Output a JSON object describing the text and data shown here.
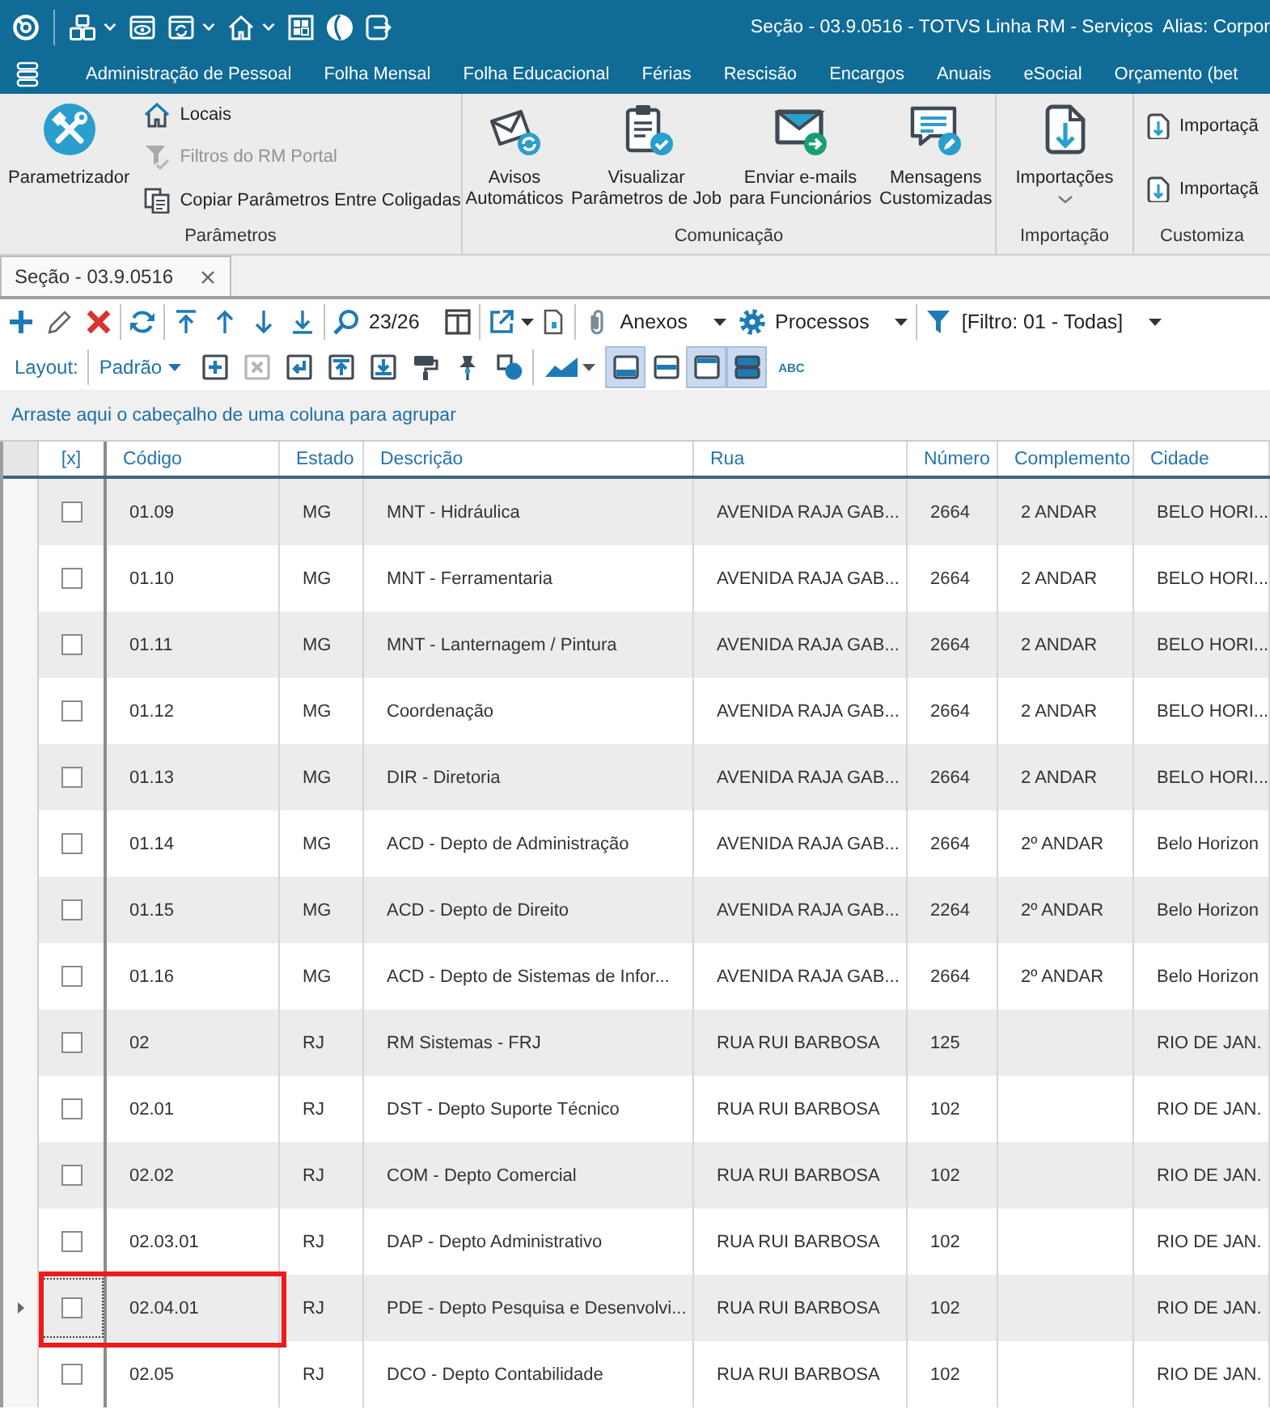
{
  "title_bar": {
    "title": "Seção - 03.9.0516 - TOTVS Linha RM - Serviços  Alias: Corpor"
  },
  "menu": [
    "Administração de Pessoal",
    "Folha Mensal",
    "Folha Educacional",
    "Férias",
    "Rescisão",
    "Encargos",
    "Anuais",
    "eSocial",
    "Orçamento (bet"
  ],
  "ribbon": {
    "groups": [
      {
        "label": "Parâmetros",
        "large": [
          {
            "label": "Parametrizador"
          }
        ],
        "small": [
          {
            "label": "Locais",
            "disabled": false
          },
          {
            "label": "Filtros do RM Portal",
            "disabled": true
          },
          {
            "label": "Copiar Parâmetros Entre Coligadas",
            "disabled": false
          }
        ]
      },
      {
        "label": "Comunicação",
        "large": [
          {
            "label": "Avisos\nAutomáticos"
          },
          {
            "label": "Visualizar\nParâmetros de Job"
          },
          {
            "label": "Enviar e-mails\npara Funcionários"
          },
          {
            "label": "Mensagens\nCustomizadas"
          }
        ]
      },
      {
        "label": "Importação",
        "large": [
          {
            "label": "Importações",
            "dropdown": true
          }
        ]
      },
      {
        "label": "Customiza",
        "small": [
          {
            "label": "Importaçã",
            "disabled": false
          },
          {
            "label": "Importaçã",
            "disabled": false
          }
        ]
      }
    ]
  },
  "tabs": [
    {
      "label": "Seção - 03.9.0516",
      "selected": true
    }
  ],
  "toolbar": {
    "record_counter": "23/26",
    "attachments": "Anexos",
    "processes": "Processos",
    "filter": "[Filtro: 01 - Todas]"
  },
  "layout_bar": {
    "label": "Layout:",
    "layout": "Padrão",
    "tools": [
      {
        "disabled": false
      },
      {
        "disabled": true
      },
      {
        "disabled": false
      },
      {
        "disabled": false
      },
      {
        "disabled": false
      },
      {
        "disabled": false
      },
      {
        "disabled": false
      },
      {
        "disabled": false
      }
    ],
    "view_toggles": [
      {
        "selected": true
      },
      {
        "selected": false
      },
      {
        "selected": true
      },
      {
        "selected": true
      }
    ],
    "spelling": "ABC"
  },
  "group_panel": {
    "hint": "Arraste aqui o cabeçalho de uma coluna para agrupar"
  },
  "table": {
    "columns": [
      "[x]",
      "Código",
      "Estado",
      "Descrição",
      "Rua",
      "Número",
      "Complemento",
      "Cidade"
    ],
    "rows": [
      {
        "checked": false,
        "selected": false,
        "highlighted": false,
        "code": "01.09",
        "state": "MG",
        "description": "MNT - Hidráulica",
        "street": "AVENIDA RAJA GAB...",
        "number": "2664",
        "complement": "2 ANDAR",
        "city": "BELO HORI..."
      },
      {
        "checked": false,
        "selected": false,
        "highlighted": false,
        "code": "01.10",
        "state": "MG",
        "description": "MNT - Ferramentaria",
        "street": "AVENIDA RAJA GAB...",
        "number": "2664",
        "complement": "2 ANDAR",
        "city": "BELO HORI..."
      },
      {
        "checked": false,
        "selected": false,
        "highlighted": false,
        "code": "01.11",
        "state": "MG",
        "description": "MNT - Lanternagem / Pintura",
        "street": "AVENIDA RAJA GAB...",
        "number": "2664",
        "complement": "2 ANDAR",
        "city": "BELO HORI..."
      },
      {
        "checked": false,
        "selected": false,
        "highlighted": false,
        "code": "01.12",
        "state": "MG",
        "description": "Coordenação",
        "street": "AVENIDA RAJA GAB...",
        "number": "2664",
        "complement": "2 ANDAR",
        "city": "BELO HORI..."
      },
      {
        "checked": false,
        "selected": false,
        "highlighted": false,
        "code": "01.13",
        "state": "MG",
        "description": "DIR - Diretoria",
        "street": "AVENIDA RAJA GAB...",
        "number": "2664",
        "complement": "2 ANDAR",
        "city": "BELO HORI..."
      },
      {
        "checked": false,
        "selected": false,
        "highlighted": false,
        "code": "01.14",
        "state": "MG",
        "description": "ACD - Depto de Administração",
        "street": "AVENIDA RAJA GAB...",
        "number": "2664",
        "complement": "2º ANDAR",
        "city": "Belo Horizon"
      },
      {
        "checked": false,
        "selected": false,
        "highlighted": false,
        "code": "01.15",
        "state": "MG",
        "description": "ACD - Depto de Direito",
        "street": "AVENIDA RAJA GAB...",
        "number": "2264",
        "complement": "2º ANDAR",
        "city": "Belo Horizon"
      },
      {
        "checked": false,
        "selected": false,
        "highlighted": false,
        "code": "01.16",
        "state": "MG",
        "description": "ACD - Depto de Sistemas de Infor...",
        "street": "AVENIDA RAJA GAB...",
        "number": "2664",
        "complement": "2º ANDAR",
        "city": "Belo Horizon"
      },
      {
        "checked": false,
        "selected": false,
        "highlighted": false,
        "code": "02",
        "state": "RJ",
        "description": "RM Sistemas - FRJ",
        "street": "RUA RUI BARBOSA",
        "number": "125",
        "city": "RIO DE JAN."
      },
      {
        "checked": false,
        "selected": false,
        "highlighted": false,
        "code": "02.01",
        "state": "RJ",
        "description": "DST - Depto Suporte Técnico",
        "street": "RUA RUI BARBOSA",
        "number": "102",
        "city": "RIO DE JAN."
      },
      {
        "checked": false,
        "selected": false,
        "highlighted": false,
        "code": "02.02",
        "state": "RJ",
        "description": "COM - Depto Comercial",
        "street": "RUA RUI BARBOSA",
        "number": "102",
        "city": "RIO DE JAN."
      },
      {
        "checked": false,
        "selected": false,
        "highlighted": false,
        "code": "02.03.01",
        "state": "RJ",
        "description": "DAP - Depto Administrativo",
        "street": "RUA RUI BARBOSA",
        "number": "102",
        "city": "RIO DE JAN."
      },
      {
        "checked": false,
        "selected": true,
        "highlighted": true,
        "code": "02.04.01",
        "state": "RJ",
        "description": "PDE - Depto Pesquisa e Desenvolvi...",
        "street": "RUA RUI BARBOSA",
        "number": "102",
        "city": "RIO DE JAN."
      },
      {
        "checked": false,
        "selected": false,
        "highlighted": false,
        "code": "02.05",
        "state": "RJ",
        "description": "DCO - Depto Contabilidade",
        "street": "RUA RUI BARBOSA",
        "number": "102",
        "city": "RIO DE JAN."
      }
    ]
  }
}
